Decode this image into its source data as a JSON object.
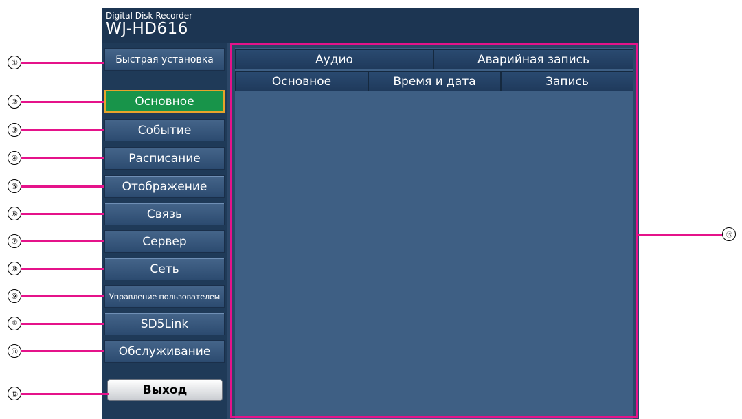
{
  "header": {
    "brand_sub": "Digital Disk Recorder",
    "model": "WJ-HD616"
  },
  "sidebar": {
    "quick_setup": "Быстрая установка",
    "items": [
      {
        "label": "Основное"
      },
      {
        "label": "Событие"
      },
      {
        "label": "Расписание"
      },
      {
        "label": "Отображение"
      },
      {
        "label": "Связь"
      },
      {
        "label": "Сервер"
      },
      {
        "label": "Сеть"
      },
      {
        "label": "Управление пользователем"
      },
      {
        "label": "SD5Link"
      },
      {
        "label": "Обслуживание"
      }
    ],
    "active_item": "Основное",
    "exit": "Выход"
  },
  "tabs": {
    "row1": [
      "Аудио",
      "Аварийная запись"
    ],
    "row2": [
      "Основное",
      "Время и дата",
      "Запись"
    ]
  },
  "callouts": [
    "①",
    "②",
    "③",
    "④",
    "⑤",
    "⑥",
    "⑦",
    "⑧",
    "⑨",
    "⑩",
    "⑪",
    "⑫",
    "⑬"
  ],
  "colors": {
    "screen_bg": "#2b4767",
    "active_item": "#18944a",
    "active_border": "#e8a32a",
    "annotation": "#e5138a"
  }
}
